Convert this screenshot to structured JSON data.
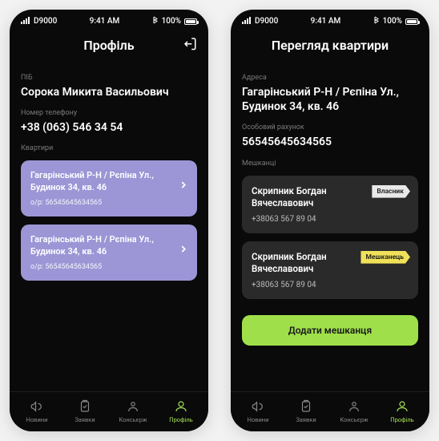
{
  "status": {
    "carrier": "D9000",
    "time": "9:41 AM",
    "battery": "100%"
  },
  "screen1": {
    "title": "Профіль",
    "fullname_label": "ПІБ",
    "fullname": "Сорока Микита Васильович",
    "phone_label": "Номер телефону",
    "phone": "+38 (063) 546 34 54",
    "apartments_label": "Квартири",
    "apartments": [
      {
        "address": "Гагарінський Р-Н / Рєпіна Ул., Будинок 34, кв. 46",
        "op_label": "о/р:",
        "account": "56545645634565"
      },
      {
        "address": "Гагарінський Р-Н / Рєпіна Ул., Будинок 34, кв. 46",
        "op_label": "о/р:",
        "account": "56545645634565"
      }
    ]
  },
  "screen2": {
    "title": "Перегляд квартири",
    "address_label": "Адреса",
    "address": "Гагарінський Р-Н / Рєпіна Ул., Будинок 34, кв. 46",
    "account_label": "Особовий рахунок",
    "account": "56545645634565",
    "residents_label": "Мешканці",
    "residents": [
      {
        "name": "Скрипник Богдан Вячеславович",
        "phone": "+38063 567 89 04",
        "badge": "Власник",
        "badge_type": "owner"
      },
      {
        "name": "Скрипник Богдан Вячеславович",
        "phone": "+38063 567 89 04",
        "badge": "Мешканець",
        "badge_type": "resident"
      }
    ],
    "add_button": "Додати мешканця"
  },
  "tabs": [
    {
      "label": "Новини"
    },
    {
      "label": "Заявки"
    },
    {
      "label": "Консьєрж"
    },
    {
      "label": "Профіль"
    }
  ],
  "colors": {
    "accent_green": "#9fe04a",
    "card_purple": "#9c96d6",
    "card_dark": "#2a2a2a",
    "badge_yellow": "#f0e158"
  }
}
